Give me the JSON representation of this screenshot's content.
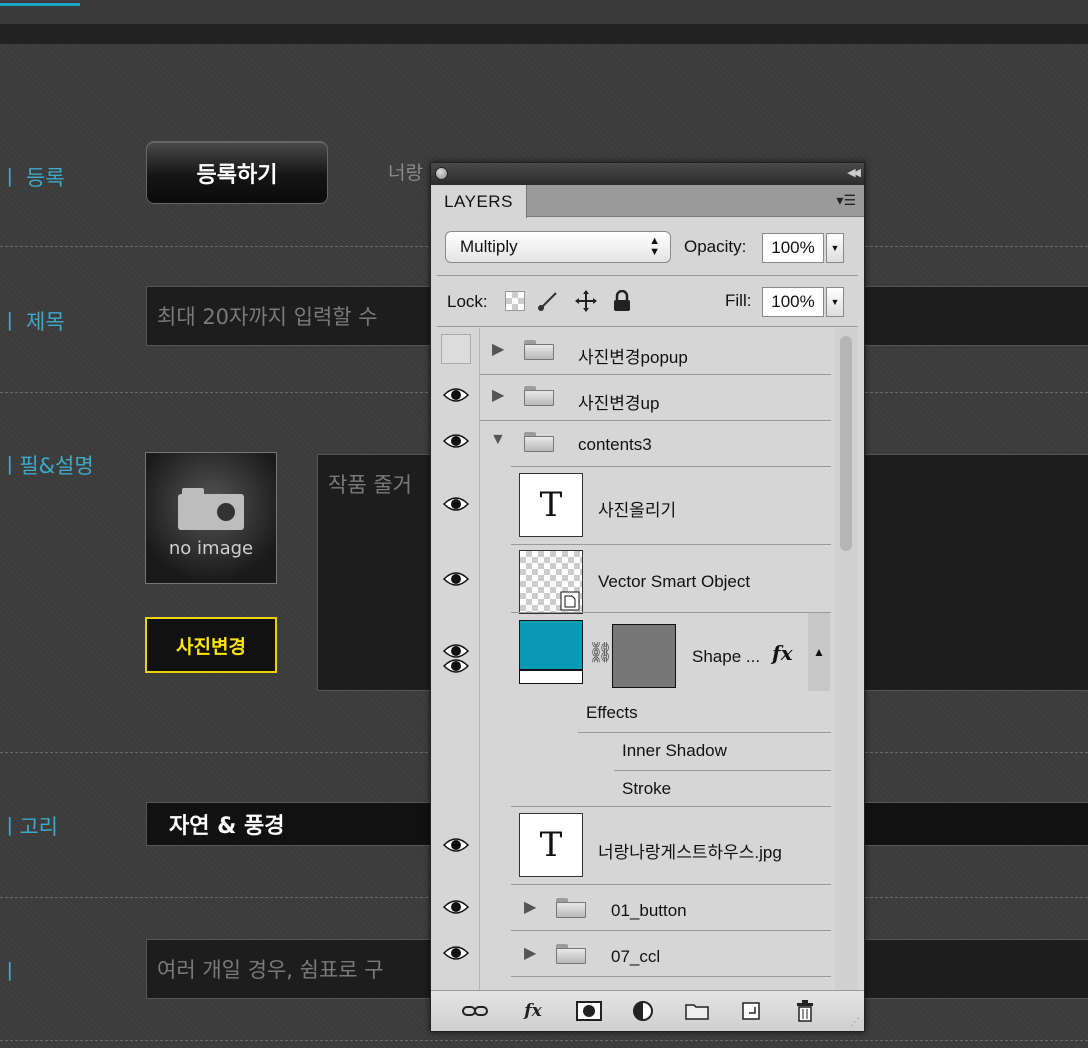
{
  "form": {
    "row1_label": "ㅣ 등록",
    "register_button": "등록하기",
    "hint_text": "너랑",
    "row2_label": "ㅣ 제목",
    "title_placeholder": "최대 20자까지 입력할 수",
    "row3_label": "ㅣ필&설명",
    "noimage_label": "no image",
    "photo_change_button": "사진변경",
    "description_placeholder": "작품 줄거",
    "row4_label": "ㅣ고리",
    "category_value": "자연 & 풍경",
    "row5_label": "ㅣ",
    "tags_placeholder": "여러 개일 경우, 쉼표로 구"
  },
  "panel": {
    "tab_label": "LAYERS",
    "blend_mode": "Multiply",
    "opacity_label": "Opacity:",
    "opacity_value": "100%",
    "lock_label": "Lock:",
    "fill_label": "Fill:",
    "fill_value": "100%",
    "layers": {
      "popup": "사진변경popup",
      "up": "사진변경up",
      "contents3": "contents3",
      "text1": "사진올리기",
      "smart": "Vector Smart Object",
      "shape": "Shape ...",
      "effects": "Effects",
      "inner_shadow": "Inner Shadow",
      "stroke": "Stroke",
      "text2": "너랑나랑게스트하우스.jpg",
      "button": "01_button",
      "ccl": "07_ccl"
    },
    "thumb_text_glyph": "T",
    "fx_glyph": "fx"
  },
  "colors": {
    "accent": "#1aa3c4",
    "shape_fill": "#0a9ab5",
    "photo_button_border": "#e8d200"
  },
  "icons": [
    "close-icon",
    "collapse-icon",
    "panel-menu-icon",
    "eye-icon",
    "folder-icon",
    "link-icon",
    "fx-icon",
    "mask-icon",
    "adjustment-icon",
    "new-group-icon",
    "new-layer-icon",
    "trash-icon",
    "camera-icon"
  ]
}
